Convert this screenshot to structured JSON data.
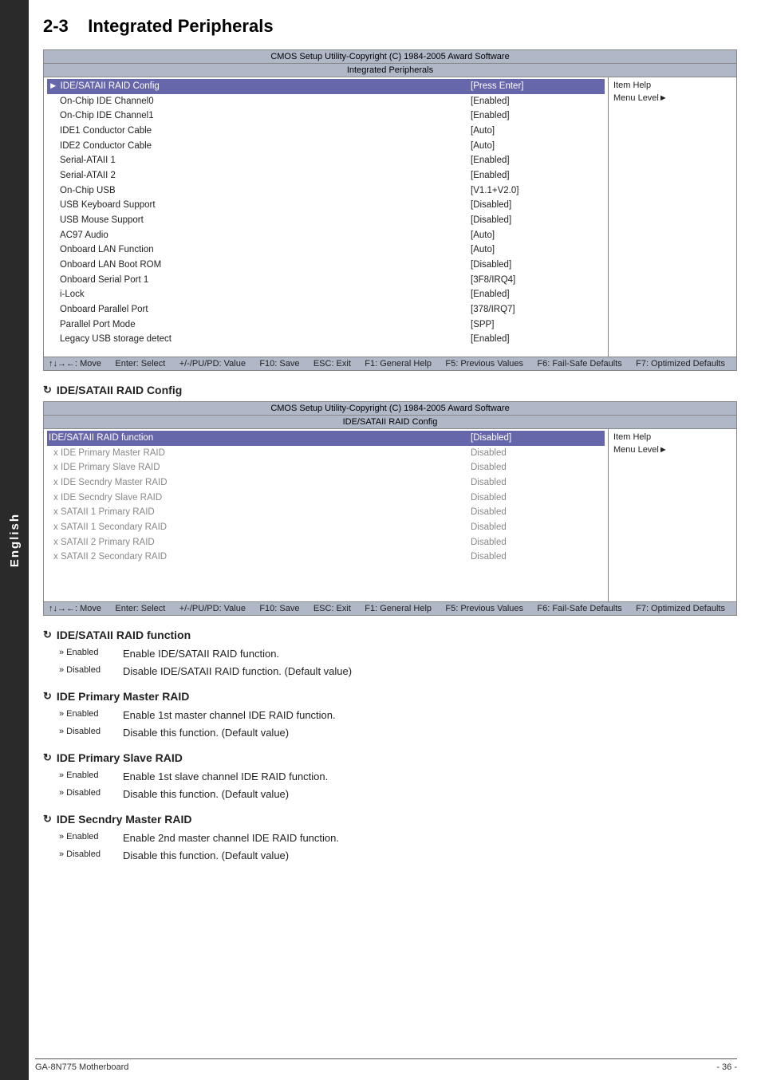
{
  "sidebar": {
    "label": "English"
  },
  "page": {
    "section_num": "2-3",
    "title": "Integrated Peripherals"
  },
  "bios_table1": {
    "header1": "CMOS Setup Utility-Copyright (C) 1984-2005 Award Software",
    "header2": "Integrated Peripherals",
    "rows": [
      {
        "label": "IDE/SATAII RAID Config",
        "value": "[Press Enter]",
        "highlighted": true,
        "indent": false
      },
      {
        "label": "On-Chip IDE Channel0",
        "value": "[Enabled]",
        "highlighted": false,
        "indent": true
      },
      {
        "label": "On-Chip IDE Channel1",
        "value": "[Enabled]",
        "highlighted": false,
        "indent": true
      },
      {
        "label": "IDE1 Conductor Cable",
        "value": "[Auto]",
        "highlighted": false,
        "indent": true
      },
      {
        "label": "IDE2 Conductor Cable",
        "value": "[Auto]",
        "highlighted": false,
        "indent": true
      },
      {
        "label": "Serial-ATAII 1",
        "value": "[Enabled]",
        "highlighted": false,
        "indent": true
      },
      {
        "label": "Serial-ATAII 2",
        "value": "[Enabled]",
        "highlighted": false,
        "indent": true
      },
      {
        "label": "On-Chip USB",
        "value": "[V1.1+V2.0]",
        "highlighted": false,
        "indent": true
      },
      {
        "label": "USB Keyboard Support",
        "value": "[Disabled]",
        "highlighted": false,
        "indent": true
      },
      {
        "label": "USB Mouse Support",
        "value": "[Disabled]",
        "highlighted": false,
        "indent": true
      },
      {
        "label": "AC97 Audio",
        "value": "[Auto]",
        "highlighted": false,
        "indent": true
      },
      {
        "label": "Onboard LAN Function",
        "value": "[Auto]",
        "highlighted": false,
        "indent": true
      },
      {
        "label": "Onboard LAN Boot ROM",
        "value": "[Disabled]",
        "highlighted": false,
        "indent": true
      },
      {
        "label": "Onboard Serial Port 1",
        "value": "[3F8/IRQ4]",
        "highlighted": false,
        "indent": true
      },
      {
        "label": "i-Lock",
        "value": "[Enabled]",
        "highlighted": false,
        "indent": true
      },
      {
        "label": "Onboard Parallel Port",
        "value": "[378/IRQ7]",
        "highlighted": false,
        "indent": true
      },
      {
        "label": "Parallel Port Mode",
        "value": "[SPP]",
        "highlighted": false,
        "indent": true
      },
      {
        "label": "Legacy USB storage detect",
        "value": "[Enabled]",
        "highlighted": false,
        "indent": true
      }
    ],
    "item_help": "Item Help",
    "menu_level": "Menu Level►",
    "nav": {
      "move": "↑↓→←: Move",
      "enter": "Enter: Select",
      "value": "+/-/PU/PD: Value",
      "f10": "F10: Save",
      "esc": "ESC: Exit",
      "f1": "F1: General Help",
      "f5": "F5: Previous Values",
      "f6": "F6: Fail-Safe Defaults",
      "f7": "F7: Optimized Defaults"
    }
  },
  "section1": {
    "heading": "IDE/SATAII RAID Config",
    "arrow": "↳"
  },
  "bios_table2": {
    "header1": "CMOS Setup Utility-Copyright (C) 1984-2005 Award Software",
    "header2": "IDE/SATAII RAID Config",
    "rows": [
      {
        "label": "IDE/SATAII RAID function",
        "value": "[Disabled]",
        "highlighted": true,
        "dimmed": false,
        "indent": false
      },
      {
        "label": "IDE Primary Master RAID",
        "value": "Disabled",
        "highlighted": false,
        "dimmed": true,
        "indent": true,
        "prefix": "x"
      },
      {
        "label": "IDE Primary Slave RAID",
        "value": "Disabled",
        "highlighted": false,
        "dimmed": true,
        "indent": true,
        "prefix": "x"
      },
      {
        "label": "IDE Secndry Master RAID",
        "value": "Disabled",
        "highlighted": false,
        "dimmed": true,
        "indent": true,
        "prefix": "x"
      },
      {
        "label": "IDE Secndry Slave RAID",
        "value": "Disabled",
        "highlighted": false,
        "dimmed": true,
        "indent": true,
        "prefix": "x"
      },
      {
        "label": "SATAII 1 Primary RAID",
        "value": "Disabled",
        "highlighted": false,
        "dimmed": true,
        "indent": true,
        "prefix": "x"
      },
      {
        "label": "SATAII 1 Secondary RAID",
        "value": "Disabled",
        "highlighted": false,
        "dimmed": true,
        "indent": true,
        "prefix": "x"
      },
      {
        "label": "SATAII 2 Primary RAID",
        "value": "Disabled",
        "highlighted": false,
        "dimmed": true,
        "indent": true,
        "prefix": "x"
      },
      {
        "label": "SATAII 2 Secondary RAID",
        "value": "Disabled",
        "highlighted": false,
        "dimmed": true,
        "indent": true,
        "prefix": "x"
      }
    ],
    "item_help": "Item Help",
    "menu_level": "Menu Level►"
  },
  "sections": [
    {
      "id": "ide-sataii-raid-function",
      "heading": "IDE/SATAII RAID function",
      "items": [
        {
          "bullet": "» Enabled",
          "text": "Enable IDE/SATAII RAID function."
        },
        {
          "bullet": "» Disabled",
          "text": "Disable IDE/SATAII RAID function. (Default value)"
        }
      ]
    },
    {
      "id": "ide-primary-master-raid",
      "heading": "IDE Primary Master RAID",
      "items": [
        {
          "bullet": "» Enabled",
          "text": "Enable 1st master channel IDE RAID function."
        },
        {
          "bullet": "» Disabled",
          "text": "Disable this function. (Default value)"
        }
      ]
    },
    {
      "id": "ide-primary-slave-raid",
      "heading": "IDE Primary Slave RAID",
      "items": [
        {
          "bullet": "» Enabled",
          "text": "Enable 1st slave channel IDE RAID function."
        },
        {
          "bullet": "» Disabled",
          "text": "Disable this function. (Default value)"
        }
      ]
    },
    {
      "id": "ide-secndry-master-raid",
      "heading": "IDE Secndry Master RAID",
      "items": [
        {
          "bullet": "» Enabled",
          "text": "Enable 2nd master channel IDE RAID function."
        },
        {
          "bullet": "» Disabled",
          "text": "Disable this function. (Default value)"
        }
      ]
    }
  ],
  "footer": {
    "left": "GA-8N775 Motherboard",
    "right": "- 36 -"
  }
}
